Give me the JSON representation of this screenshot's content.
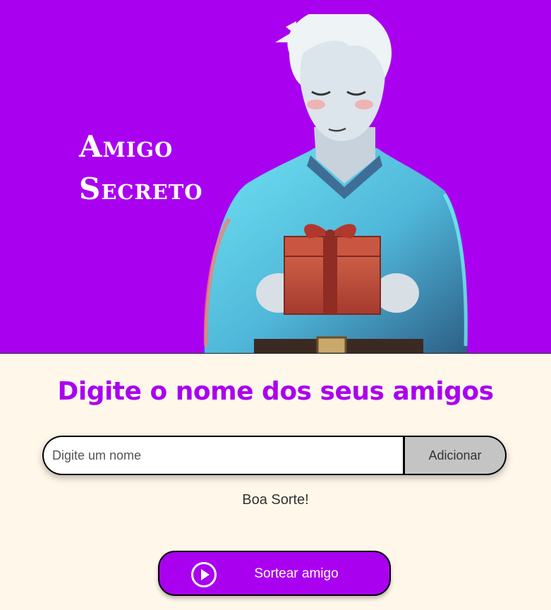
{
  "header": {
    "title_line1": "Amigo",
    "title_line2": "Secreto",
    "background_color": "#AA00F0",
    "illustration": "person-holding-gift-icon"
  },
  "main": {
    "heading": "Digite o nome dos seus amigos",
    "name_input": {
      "placeholder": "Digite um nome",
      "value": ""
    },
    "add_button_label": "Adicionar",
    "result_text": "Boa Sorte!",
    "draw_button": {
      "label": "Sortear amigo",
      "icon": "play-circle-icon"
    }
  },
  "colors": {
    "accent": "#AA00F0",
    "page_background": "#FFF8EA",
    "add_button": "#C4C4C4"
  }
}
